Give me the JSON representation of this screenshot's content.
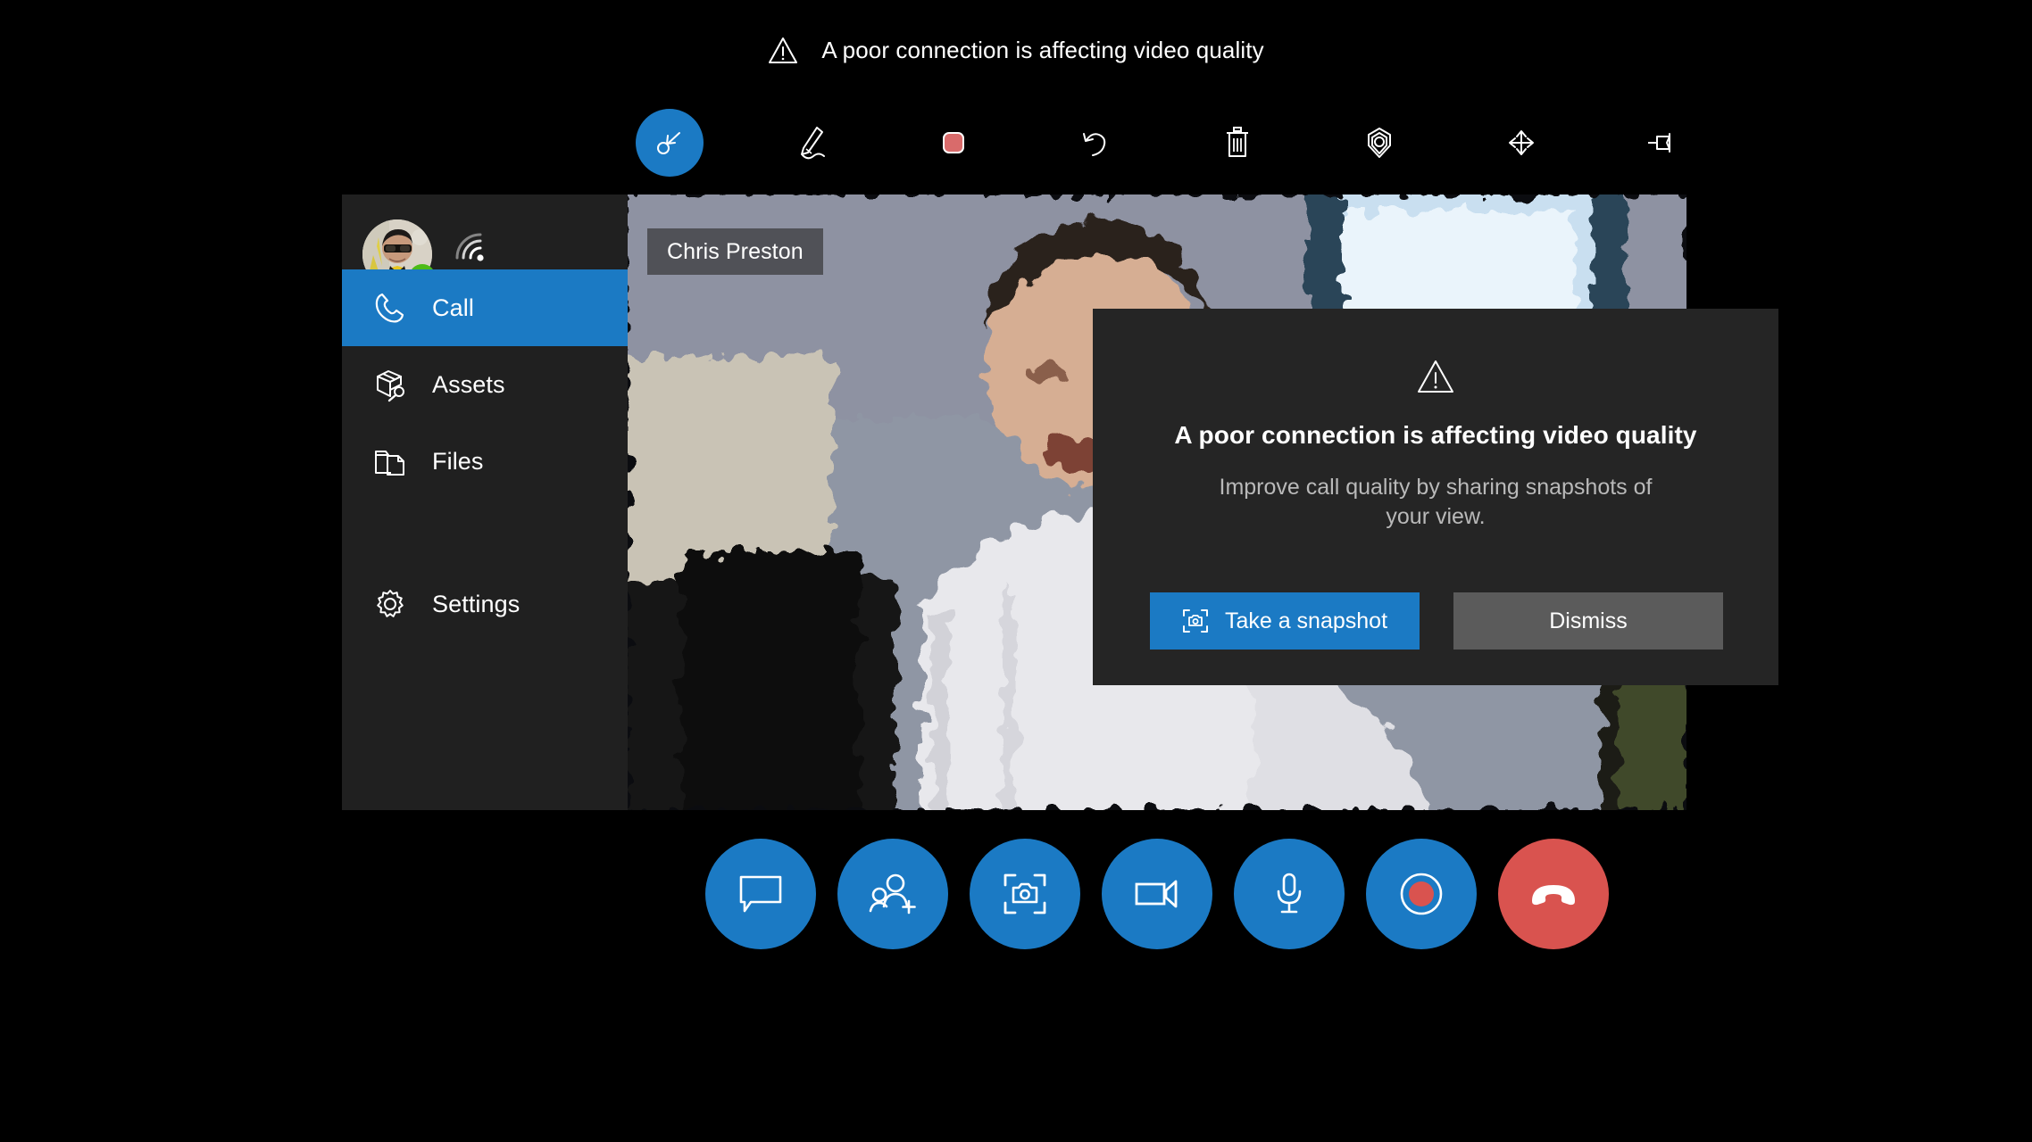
{
  "banner": {
    "icon": "warning-triangle-icon",
    "text": "A poor connection is affecting video quality"
  },
  "annotation_toolbar": {
    "tools": [
      {
        "id": "select-collapse",
        "label": "Select",
        "icon": "collapse-arrow-icon",
        "active": true
      },
      {
        "id": "ink",
        "label": "Ink",
        "icon": "pen-icon",
        "active": false
      },
      {
        "id": "shape",
        "label": "Shape",
        "icon": "rounded-square-icon",
        "active": false
      },
      {
        "id": "undo",
        "label": "Undo",
        "icon": "undo-arrow-icon",
        "active": false
      },
      {
        "id": "delete",
        "label": "Delete",
        "icon": "trash-icon",
        "active": false
      },
      {
        "id": "place",
        "label": "Place",
        "icon": "location-pin-icon",
        "active": false
      },
      {
        "id": "move",
        "label": "Move",
        "icon": "move-arrows-icon",
        "active": false
      },
      {
        "id": "pin",
        "label": "Pin",
        "icon": "pushpin-icon",
        "active": false
      }
    ]
  },
  "sidebar": {
    "profile": {
      "presence": "available",
      "presence_icon": "check-badge-icon",
      "signal_icon": "signal-strength-icon"
    },
    "items": [
      {
        "id": "call",
        "label": "Call",
        "icon": "phone-icon",
        "active": true
      },
      {
        "id": "assets",
        "label": "Assets",
        "icon": "box-wrench-icon",
        "active": false
      },
      {
        "id": "files",
        "label": "Files",
        "icon": "folder-document-icon",
        "active": false
      },
      {
        "id": "settings",
        "label": "Settings",
        "icon": "gear-icon",
        "active": false
      }
    ]
  },
  "video": {
    "participant_name": "Chris Preston"
  },
  "dialog": {
    "icon": "warning-triangle-icon",
    "title": "A poor connection is affecting video quality",
    "body": "Improve call quality by sharing snapshots of your view.",
    "primary_button": {
      "label": "Take a snapshot",
      "icon": "camera-frame-icon"
    },
    "secondary_button": {
      "label": "Dismiss"
    }
  },
  "call_controls": [
    {
      "id": "chat",
      "label": "Chat",
      "icon": "chat-bubble-icon"
    },
    {
      "id": "add-people",
      "label": "Add people",
      "icon": "add-person-icon"
    },
    {
      "id": "snapshot",
      "label": "Take snapshot",
      "icon": "camera-frame-icon"
    },
    {
      "id": "video",
      "label": "Video",
      "icon": "video-camera-icon"
    },
    {
      "id": "mic",
      "label": "Microphone",
      "icon": "microphone-icon"
    },
    {
      "id": "record",
      "label": "Record",
      "icon": "record-icon"
    },
    {
      "id": "hangup",
      "label": "End call",
      "icon": "hangup-phone-icon"
    }
  ],
  "colors": {
    "accent": "#1b7ac4",
    "danger": "#d9534f",
    "panel": "#202020",
    "dialog": "#252525",
    "presence": "#4cbb17",
    "background": "#000000"
  }
}
